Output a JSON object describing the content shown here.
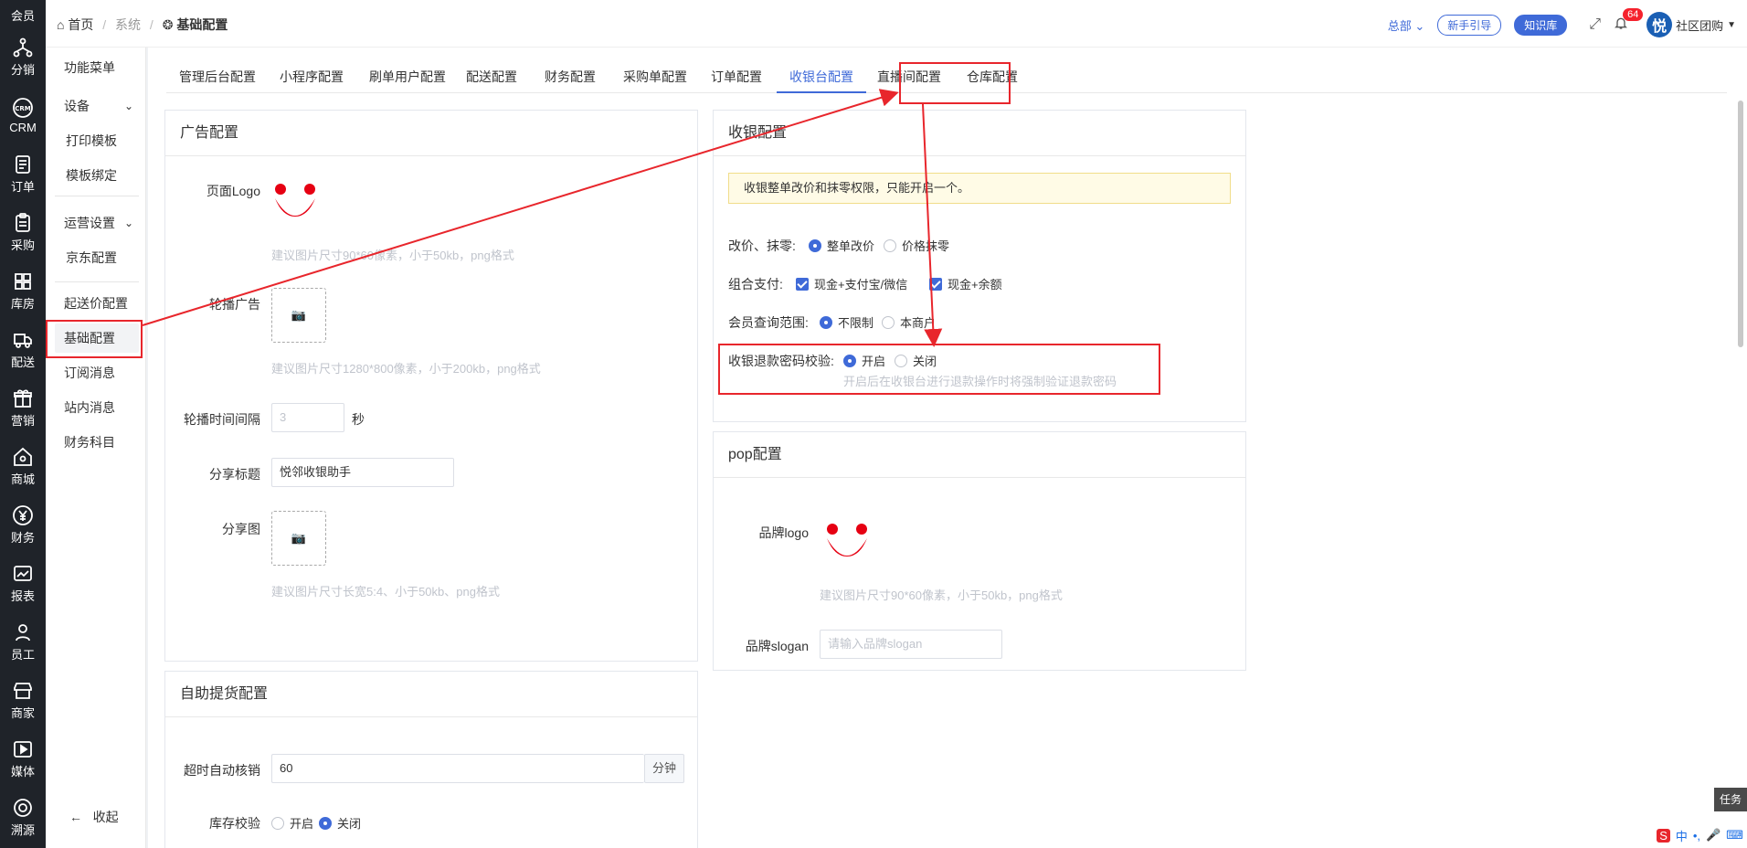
{
  "iconbar": {
    "items": [
      "会员",
      "分销",
      "CRM",
      "订单",
      "采购",
      "库房",
      "配送",
      "营销",
      "商城",
      "财务",
      "报表",
      "员工",
      "商家",
      "媒体",
      "溯源"
    ]
  },
  "sidenav": {
    "items": [
      "功能菜单",
      "设备",
      "打印模板",
      "模板绑定",
      "运营设置",
      "京东配置",
      "起送价配置",
      "基础配置",
      "订阅消息",
      "站内消息",
      "财务科目"
    ],
    "collapse": "收起"
  },
  "header": {
    "breadcrumb": [
      "首页",
      "系统",
      "基础配置"
    ],
    "store": "总部",
    "guide": "新手引导",
    "kb": "知识库",
    "notif_count": "64",
    "avatar_char": "悦",
    "user": "社区团购"
  },
  "tabs": [
    "管理后台配置",
    "小程序配置",
    "刷单用户配置",
    "配送配置",
    "财务配置",
    "采购单配置",
    "订单配置",
    "收银台配置",
    "直播间配置",
    "仓库配置"
  ],
  "ad_panel": {
    "title": "广告配置",
    "logo_label": "页面Logo",
    "logo_hint": "建议图片尺寸90*60像素，小于50kb，png格式",
    "carousel_label": "轮播广告",
    "carousel_hint": "建议图片尺寸1280*800像素，小于200kb，png格式",
    "interval_label": "轮播时间间隔",
    "interval_value": "3",
    "interval_unit": "秒",
    "share_title_label": "分享标题",
    "share_title_value": "悦邻收银助手",
    "share_img_label": "分享图",
    "share_img_hint": "建议图片尺寸长宽5:4、小于50kb、png格式"
  },
  "pickup_panel": {
    "title": "自助提货配置",
    "timeout_label": "超时自动核销",
    "timeout_value": "60",
    "timeout_unit": "分钟",
    "stock_label": "库存校验",
    "stock_on": "开启",
    "stock_off": "关闭"
  },
  "cashier_panel": {
    "title": "收银配置",
    "notice": "收银整单改价和抹零权限，只能开启一个。",
    "price_label": "改价、抹零:",
    "price_opt1": "整单改价",
    "price_opt2": "价格抹零",
    "pay_label": "组合支付:",
    "pay_opt1": "现金+支付宝/微信",
    "pay_opt2": "现金+余额",
    "member_label": "会员查询范围:",
    "member_opt1": "不限制",
    "member_opt2": "本商户",
    "refund_label": "收银退款密码校验:",
    "refund_on": "开启",
    "refund_off": "关闭",
    "refund_hint": "开启后在收银台进行退款操作时将强制验证退款密码"
  },
  "pop_panel": {
    "title": "pop配置",
    "brand_logo_label": "品牌logo",
    "brand_logo_hint": "建议图片尺寸90*60像素，小于50kb，png格式",
    "slogan_label": "品牌slogan",
    "slogan_placeholder": "请输入品牌slogan"
  },
  "misc": {
    "task": "任务",
    "tray": "中"
  },
  "colors": {
    "accent": "#3f6ad8",
    "annotation": "#e8262c",
    "logo_red": "#e60012"
  }
}
